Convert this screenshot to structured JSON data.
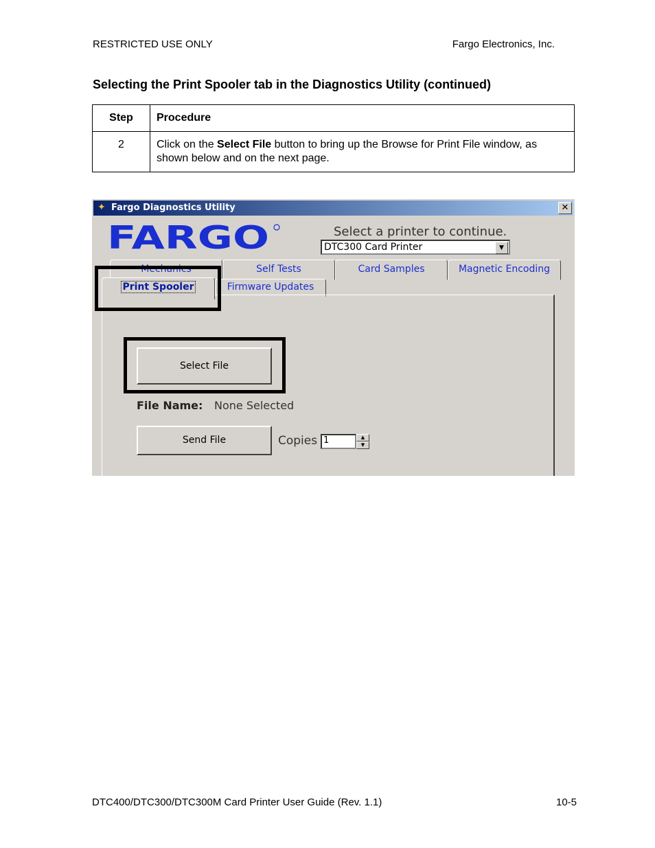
{
  "header": {
    "left": "RESTRICTED USE ONLY",
    "right": "Fargo Electronics, Inc."
  },
  "section_title": "Selecting the Print Spooler tab in the Diagnostics Utility (continued)",
  "table": {
    "headers": [
      "Step",
      "Procedure"
    ],
    "rows": [
      {
        "step": "2",
        "pre": "Click on the ",
        "bold": "Select File",
        "post": " button to bring up the Browse for Print File window, as shown below and on the next page."
      }
    ]
  },
  "screenshot": {
    "window_title": "Fargo Diagnostics Utility",
    "close_glyph": "✕",
    "logo_text": "FARGO",
    "printer_prompt": "Select a printer to continue.",
    "printer_selected": "DTC300 Card Printer",
    "tabs": {
      "mechanics": "Mechanics",
      "self_tests": "Self Tests",
      "card_samples": "Card Samples",
      "magnetic_encoding": "Magnetic Encoding",
      "print_spooler": "Print Spooler",
      "firmware_updates": "Firmware Updates"
    },
    "select_file_label": "Select File",
    "file_name_label": "File Name:",
    "file_name_value": "None Selected",
    "send_file_label": "Send File",
    "copies_label": "Copies",
    "copies_value": "1",
    "colors": {
      "title_bar": "#0a246a",
      "tab_text": "#1a2fd0",
      "logo": "#1a2fd0",
      "dialog_bg": "#d6d3ce"
    }
  },
  "footer": {
    "left": "DTC400/DTC300/DTC300M Card Printer User Guide (Rev. 1.1)",
    "right": "10-5"
  }
}
